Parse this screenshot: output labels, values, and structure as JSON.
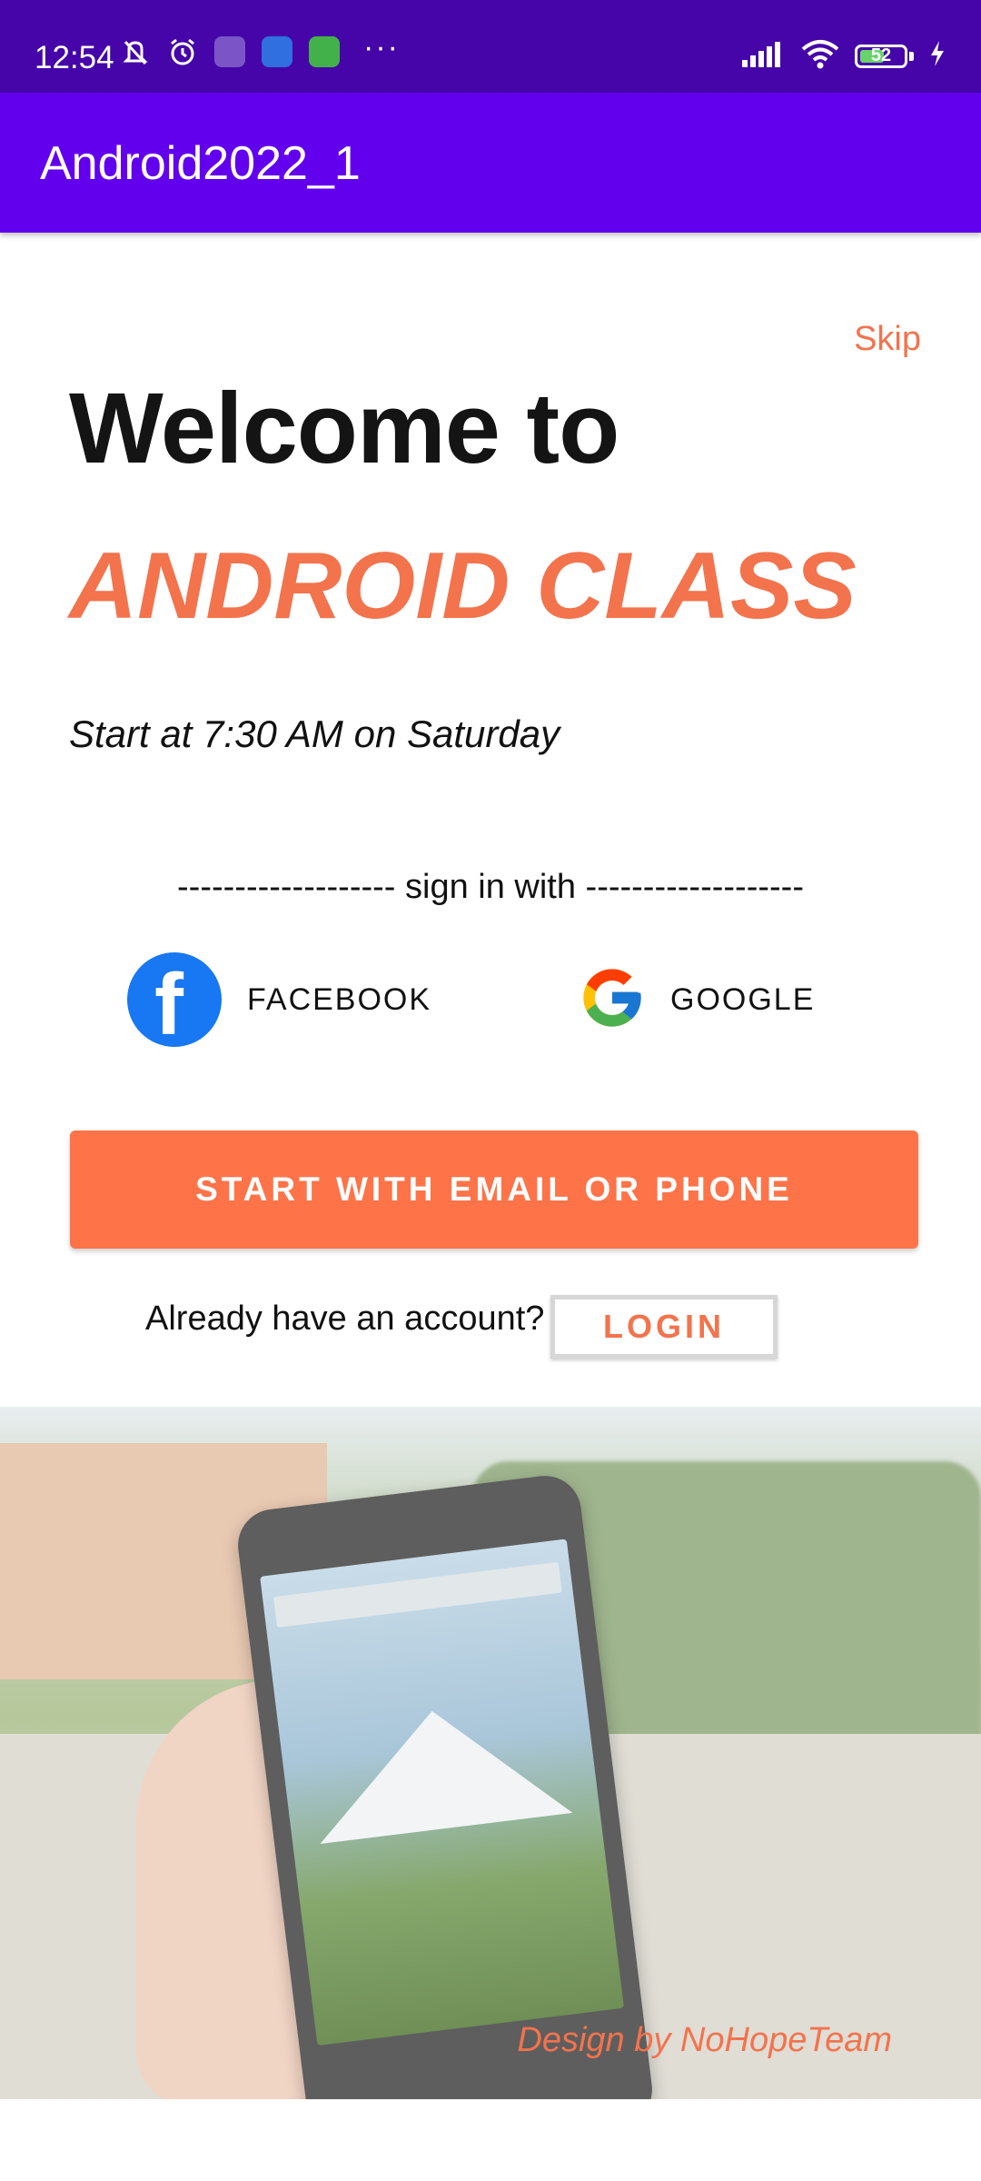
{
  "status_bar": {
    "time": "12:54",
    "more": "···",
    "battery": "52",
    "icons": [
      "mute-icon",
      "alarm-icon",
      "viber-icon",
      "messages-icon",
      "android-app-icon",
      "signal-icon",
      "wifi-icon",
      "battery-icon",
      "charging-icon"
    ]
  },
  "app_bar": {
    "title": "Android2022_1"
  },
  "welcome": {
    "skip": "Skip",
    "line1": "Welcome to",
    "line2": "ANDROID CLASS",
    "schedule": "Start at 7:30 AM on Saturday"
  },
  "signin": {
    "divider": "------------------- sign in with -------------------",
    "facebook": "FACEBOOK",
    "google": "GOOGLE",
    "primary": "START WITH EMAIL OR PHONE",
    "account_prompt": "Already have an account?",
    "login": "LOGIN"
  },
  "footer": {
    "credit": "Design by NoHopeTeam"
  },
  "colors": {
    "status_bar": "#4505a8",
    "app_bar": "#6200ee",
    "accent": "#f3734d",
    "primary_button": "#ff7348",
    "facebook": "#1877f2"
  }
}
